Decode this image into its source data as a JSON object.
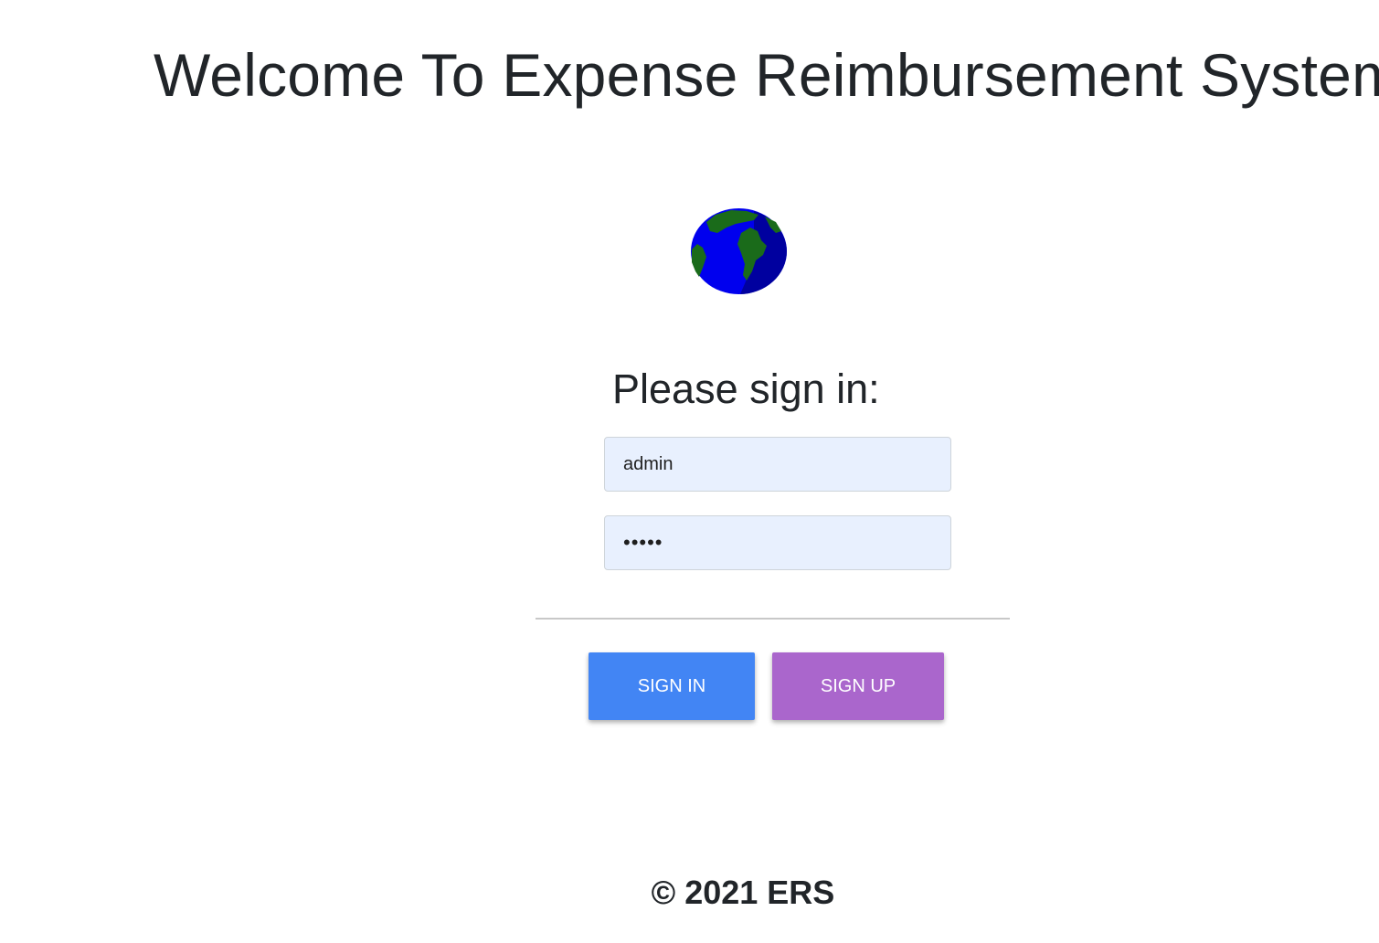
{
  "header": {
    "title": "Welcome To Expense Reimbursement System"
  },
  "logo": {
    "icon": "globe-icon",
    "colors": {
      "ocean": "#0000ee",
      "land": "#1a6b1a",
      "shade": "#00008b"
    }
  },
  "login_form": {
    "heading": "Please sign in:",
    "username_value": "admin",
    "password_value": "•••••",
    "sign_in_label": "SIGN IN",
    "sign_up_label": "SIGN UP",
    "colors": {
      "sign_in": "#4285f4",
      "sign_up": "#aa66cc",
      "field_bg": "#e8f0fe"
    }
  },
  "footer": {
    "copyright": "© 2021 ERS"
  }
}
